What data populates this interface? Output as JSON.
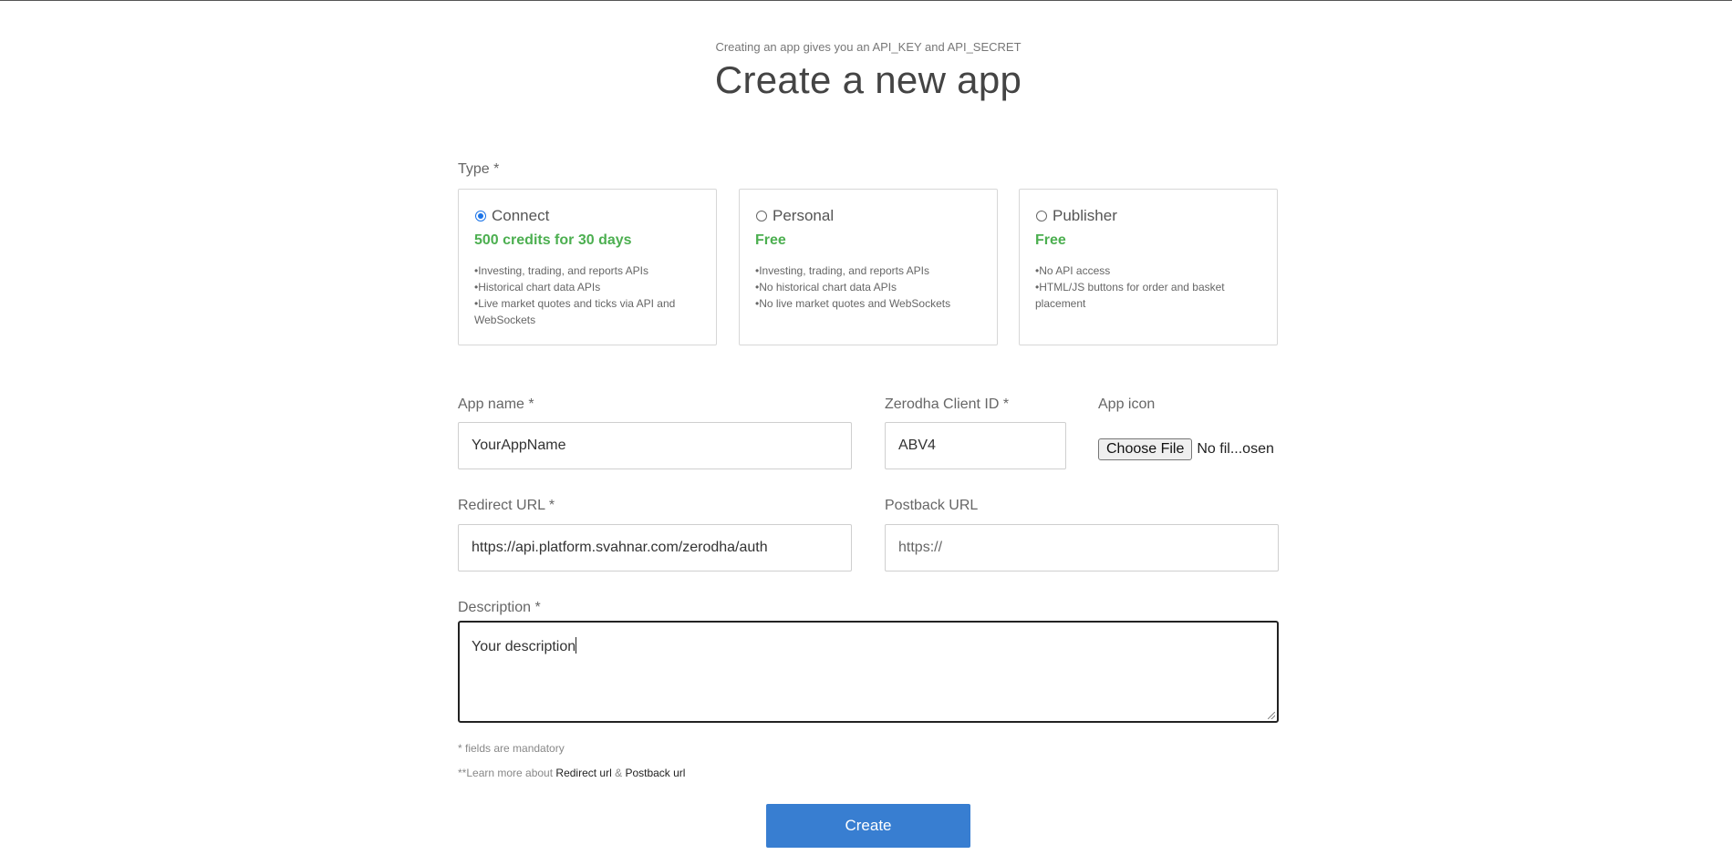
{
  "header": {
    "subtitle": "Creating an app gives you an API_KEY and API_SECRET",
    "title": "Create a new app"
  },
  "type_section": {
    "label": "Type *",
    "options": [
      {
        "name": "Connect",
        "selected": true,
        "price": "500 credits for 30 days",
        "features": [
          "Investing, trading, and reports APIs",
          "Historical chart data APIs",
          "Live market quotes and ticks via API and WebSockets"
        ]
      },
      {
        "name": "Personal",
        "selected": false,
        "price": "Free",
        "features": [
          "Investing, trading, and reports APIs",
          "No historical chart data APIs",
          "No live market quotes and WebSockets"
        ]
      },
      {
        "name": "Publisher",
        "selected": false,
        "price": "Free",
        "features": [
          "No API access",
          "HTML/JS buttons for order and basket placement"
        ]
      }
    ]
  },
  "form": {
    "app_name": {
      "label": "App name *",
      "value": "YourAppName"
    },
    "client_id": {
      "label": "Zerodha Client ID *",
      "value": "ABV4"
    },
    "app_icon": {
      "label": "App icon",
      "button": "Choose File",
      "status": "No fil...osen"
    },
    "redirect_url": {
      "label": "Redirect URL *",
      "value": "https://api.platform.svahnar.com/zerodha/auth"
    },
    "postback_url": {
      "label": "Postback URL",
      "placeholder": "https://"
    },
    "description": {
      "label": "Description *",
      "value": "Your description"
    }
  },
  "notes": {
    "mandatory": "* fields are mandatory",
    "learn_prefix": "**Learn more about ",
    "redirect_link": "Redirect url",
    "amp": " & ",
    "postback_link": "Postback url"
  },
  "actions": {
    "create_label": "Create"
  },
  "colors": {
    "accent_blue": "#387ed1",
    "price_green": "#4caf50"
  }
}
